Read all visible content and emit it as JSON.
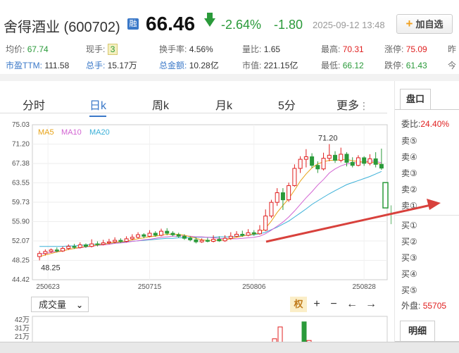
{
  "header": {
    "title": "舍得酒业 (600702)",
    "rong_badge": "融",
    "price": "66.46",
    "change_pct": "-2.64%",
    "change_abs": "-1.80",
    "timestamp": "2025-09-12 13:48",
    "add_fav_label": "加自选",
    "down_color": "#2a9a3a",
    "up_color": "#e02020"
  },
  "stats": {
    "avg_label": "均价:",
    "avg_value": "67.74",
    "hand_label": "现手:",
    "hand_value": "3",
    "turnover_label": "换手率:",
    "turnover_value": "4.56%",
    "volratio_label": "量比:",
    "volratio_value": "1.65",
    "high_label": "最高:",
    "high_value": "70.31",
    "limitup_label": "涨停:",
    "limitup_value": "75.09",
    "prevclose_label": "昨",
    "pe_label": "市盈TTM:",
    "pe_value": "111.58",
    "total_hand_label": "总手:",
    "total_hand_value": "15.17万",
    "total_amount_label": "总金额:",
    "total_amount_value": "10.28亿",
    "mktcap_label": "市值:",
    "mktcap_value": "221.15亿",
    "low_label": "最低:",
    "low_value": "66.12",
    "limitdown_label": "跌停:",
    "limitdown_value": "61.43",
    "open_label": "今"
  },
  "tabs": [
    "分时",
    "日k",
    "周k",
    "月k",
    "5分",
    "更多"
  ],
  "active_tab": "日k",
  "volume_select": "成交量",
  "tools": {
    "quan": "权",
    "plus": "+",
    "minus": "−",
    "left": "←",
    "right": "→"
  },
  "chart_data": {
    "type": "candlestick",
    "y_ticks": [
      "75.03",
      "71.20",
      "67.38",
      "63.55",
      "59.73",
      "55.90",
      "52.07",
      "48.25",
      "44.42"
    ],
    "ylim": [
      44.42,
      75.03
    ],
    "x_ticks": [
      "250623",
      "250715",
      "250806",
      "250828"
    ],
    "legend": [
      {
        "name": "MA5",
        "color": "#e8a317"
      },
      {
        "name": "MA10",
        "color": "#d264d2"
      },
      {
        "name": "MA20",
        "color": "#3bb0d8"
      }
    ],
    "annotations": {
      "max_label": "71.20",
      "min_label": "48.25"
    },
    "candles": [
      [
        49.0,
        49.6,
        48.25,
        50.1
      ],
      [
        49.6,
        50.0,
        49.2,
        50.4
      ],
      [
        50.0,
        50.3,
        49.7,
        50.6
      ],
      [
        50.3,
        50.1,
        49.8,
        50.8
      ],
      [
        50.1,
        50.6,
        49.9,
        51.0
      ],
      [
        50.6,
        51.0,
        50.3,
        51.4
      ],
      [
        51.0,
        50.8,
        50.5,
        51.5
      ],
      [
        50.8,
        51.3,
        50.6,
        51.8
      ],
      [
        51.3,
        51.0,
        50.7,
        51.6
      ],
      [
        51.0,
        51.5,
        50.8,
        52.4
      ],
      [
        51.5,
        51.4,
        51.0,
        52.0
      ],
      [
        51.4,
        51.7,
        51.2,
        52.3
      ],
      [
        51.7,
        51.9,
        51.4,
        52.5
      ],
      [
        51.9,
        52.2,
        51.6,
        52.8
      ],
      [
        52.2,
        52.0,
        51.7,
        52.6
      ],
      [
        52.0,
        52.5,
        51.8,
        53.0
      ],
      [
        52.5,
        52.8,
        52.2,
        53.4
      ],
      [
        52.8,
        53.3,
        52.5,
        53.8
      ],
      [
        53.3,
        53.0,
        52.6,
        53.6
      ],
      [
        53.0,
        53.6,
        52.8,
        54.2
      ],
      [
        53.6,
        53.2,
        52.9,
        54.0
      ],
      [
        53.2,
        54.0,
        53.0,
        54.5
      ],
      [
        54.0,
        53.6,
        53.2,
        54.6
      ],
      [
        53.6,
        53.3,
        53.0,
        54.0
      ],
      [
        53.3,
        53.0,
        52.7,
        53.7
      ],
      [
        53.0,
        52.6,
        52.3,
        53.4
      ],
      [
        52.6,
        52.3,
        52.0,
        53.0
      ],
      [
        52.3,
        51.9,
        51.6,
        52.8
      ],
      [
        51.9,
        52.2,
        51.7,
        52.6
      ],
      [
        52.2,
        52.0,
        51.8,
        52.7
      ],
      [
        52.0,
        52.4,
        51.8,
        53.2
      ],
      [
        52.4,
        52.1,
        51.9,
        53.0
      ],
      [
        52.1,
        52.6,
        51.9,
        53.2
      ],
      [
        52.6,
        53.0,
        52.3,
        53.8
      ],
      [
        53.0,
        53.4,
        52.8,
        54.0
      ],
      [
        53.4,
        53.2,
        52.9,
        54.1
      ],
      [
        53.2,
        53.7,
        53.0,
        54.4
      ],
      [
        53.7,
        53.5,
        53.1,
        54.2
      ],
      [
        53.5,
        54.2,
        53.3,
        55.2
      ],
      [
        54.2,
        57.0,
        54.0,
        58.3
      ],
      [
        57.0,
        59.7,
        56.6,
        60.2
      ],
      [
        59.7,
        61.6,
        59.0,
        62.5
      ],
      [
        61.6,
        60.2,
        58.2,
        62.5
      ],
      [
        60.2,
        63.0,
        59.8,
        63.6
      ],
      [
        63.0,
        66.4,
        62.8,
        67.2
      ],
      [
        66.4,
        68.2,
        65.5,
        68.8
      ],
      [
        68.2,
        68.7,
        66.6,
        70.2
      ],
      [
        68.7,
        67.0,
        66.5,
        69.4
      ],
      [
        67.0,
        66.3,
        65.5,
        67.8
      ],
      [
        66.3,
        68.4,
        66.0,
        69.5
      ],
      [
        68.4,
        69.0,
        67.8,
        71.2
      ],
      [
        69.0,
        68.0,
        67.5,
        69.8
      ],
      [
        68.0,
        69.2,
        67.6,
        70.5
      ],
      [
        69.2,
        67.6,
        66.8,
        69.6
      ],
      [
        67.6,
        67.0,
        66.6,
        68.6
      ],
      [
        67.0,
        68.5,
        66.8,
        69.0
      ],
      [
        68.5,
        67.4,
        66.9,
        68.8
      ],
      [
        67.4,
        68.3,
        67.0,
        69.2
      ],
      [
        68.3,
        67.2,
        66.6,
        69.6
      ],
      [
        67.2,
        66.46,
        66.12,
        70.31
      ]
    ],
    "ma5": [
      49.0,
      49.3,
      49.6,
      49.9,
      50.1,
      50.4,
      50.6,
      50.8,
      51.0,
      51.1,
      51.3,
      51.4,
      51.6,
      51.8,
      51.9,
      52.0,
      52.3,
      52.5,
      52.7,
      52.9,
      53.0,
      53.2,
      53.4,
      53.4,
      53.4,
      53.2,
      52.9,
      52.6,
      52.3,
      52.2,
      52.2,
      52.2,
      52.3,
      52.5,
      52.8,
      53.0,
      53.3,
      53.4,
      53.7,
      54.6,
      56.0,
      57.7,
      59.1,
      60.4,
      62.1,
      63.9,
      65.3,
      66.5,
      67.3,
      67.7,
      68.0,
      68.0,
      68.1,
      68.2,
      67.9,
      67.8,
      67.6,
      67.7,
      67.5,
      67.2
    ],
    "ma10": [
      49.5,
      49.6,
      49.8,
      50.0,
      50.2,
      50.4,
      50.6,
      50.7,
      50.9,
      51.0,
      51.2,
      51.3,
      51.4,
      51.6,
      51.7,
      51.8,
      52.0,
      52.1,
      52.3,
      52.4,
      52.6,
      52.8,
      52.9,
      53.0,
      53.0,
      53.1,
      53.0,
      52.9,
      52.9,
      52.8,
      52.7,
      52.6,
      52.5,
      52.5,
      52.5,
      52.6,
      52.7,
      52.8,
      53.0,
      53.5,
      54.2,
      55.0,
      55.8,
      56.8,
      58.0,
      59.3,
      60.6,
      61.8,
      63.1,
      64.2,
      65.5,
      66.3,
      66.9,
      67.3,
      67.4,
      67.6,
      67.7,
      67.9,
      67.8,
      67.5
    ],
    "ma20": [
      51.0,
      51.0,
      51.0,
      51.0,
      51.0,
      51.1,
      51.1,
      51.2,
      51.3,
      51.4,
      51.4,
      51.5,
      51.6,
      51.7,
      51.8,
      51.9,
      52.0,
      52.1,
      52.2,
      52.3,
      52.4,
      52.5,
      52.6,
      52.6,
      52.7,
      52.7,
      52.7,
      52.8,
      52.8,
      52.8,
      52.8,
      52.9,
      52.9,
      52.9,
      53.0,
      53.1,
      53.2,
      53.3,
      53.5,
      53.8,
      54.3,
      54.8,
      55.4,
      56.0,
      56.8,
      57.6,
      58.4,
      59.3,
      60.0,
      60.7,
      61.4,
      62.0,
      62.6,
      63.2,
      63.6,
      64.0,
      64.4,
      64.8,
      65.3,
      65.8
    ]
  },
  "volume_chart": {
    "y_ticks": [
      "42万",
      "31万",
      "21万"
    ],
    "bars": [
      [
        387,
        "up",
        0.4
      ],
      [
        395,
        "up",
        0.75
      ],
      [
        402,
        "up",
        0.3
      ],
      [
        429,
        "down",
        0.9
      ],
      [
        436,
        "up",
        0.35
      ],
      [
        518,
        "up",
        0.3
      ]
    ]
  },
  "side_panel": {
    "tab1": "盘口",
    "webi_label": "委比:",
    "webi_value": "24.40%",
    "sell_labels": [
      "卖⑤",
      "卖④",
      "卖③",
      "卖②",
      "卖①"
    ],
    "buy_labels": [
      "买①",
      "买②",
      "买③",
      "买④",
      "买⑤"
    ],
    "outer_label": "外盘:",
    "outer_value": "55705",
    "tab2": "明细"
  }
}
